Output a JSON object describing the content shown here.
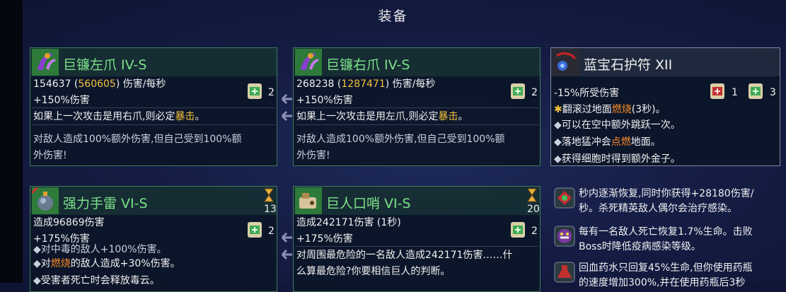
{
  "title": "装备",
  "cards": [
    {
      "name": "巨镰左爪 IV-S",
      "dps_value": "154637",
      "dps_bonus": "560605",
      "dps_suffix": "伤害/每秒",
      "bonus": "+150%伤害",
      "scroll_count": "2",
      "effect_pre": "如果上一次攻击是用右爪,则必定",
      "effect_kw": "暴击",
      "effect_post": "。",
      "curse_line1": "对敌人造成100%额外伤害,但自己受到100%额",
      "curse_line2": "外伤害!"
    },
    {
      "name": "巨镰右爪 IV-S",
      "dps_value": "268238",
      "dps_bonus": "1287471",
      "dps_suffix": "伤害/每秒",
      "bonus": "+150%伤害",
      "scroll_count": "2",
      "effect_pre": "如果上一次攻击是用左爪,则必定",
      "effect_kw": "暴击",
      "effect_post": "。",
      "curse_line1": "对敌人造成100%额外伤害,但自己受到100%额",
      "curse_line2": "外伤害!"
    },
    {
      "name": "蓝宝石护符 XII",
      "stat": "-15%所受伤害",
      "red_scroll_count": "1",
      "scroll_count": "3",
      "line_cut_pre": "翻滚过地面",
      "line_cut_kw": "燃烧",
      "line_cut_post": "(3秒)。",
      "line2": "可以在空中额外跳跃一次。",
      "line3_pre": "落地猛冲会",
      "line3_kw": "点燃",
      "line3_post": "地面。",
      "line4": "获得细胞时得到额外金子。"
    },
    {
      "name": "强力手雷 VI-S",
      "stat": "造成96869伤害",
      "bonus": "+175%伤害",
      "cooldown": "13",
      "scroll_count": "2",
      "line_cut": "对中毒的敌人+100%伤害。",
      "line2_pre": "对",
      "line2_kw": "燃烧",
      "line2_post": "的敌人造成+30%伤害。",
      "line3": "受害者死亡时会释放毒云。"
    },
    {
      "name": "巨人口哨 VI-S",
      "stat": "造成242171伤害 (1秒)",
      "bonus": "+175%伤害",
      "cooldown": "20",
      "scroll_count": "2",
      "effect_line1": "对周围最危险的一名敌人造成242171伤害……什",
      "effect_line2": "么算最危险?你要相信巨人的判断。"
    }
  ],
  "mutations": [
    {
      "line1": "秒内逐渐恢复,同时你获得+28180伤害/",
      "line2": "秒。杀死精英敌人偶尔会治疗感染。"
    },
    {
      "line1": "每有一名敌人死亡恢复1.7%生命。击败",
      "line2": "Boss时降低疫病感染等级。"
    },
    {
      "line1": "回血药水只回复45%生命,但你使用药瓶",
      "line2": "的速度增加300%,并在使用药瓶后3秒"
    }
  ],
  "colors": {
    "accent_yellow": "#f2c23e",
    "keyword_orange": "#ff8f2a",
    "item_green": "#7ee08a",
    "card_border_green": "#3f7a5a"
  }
}
